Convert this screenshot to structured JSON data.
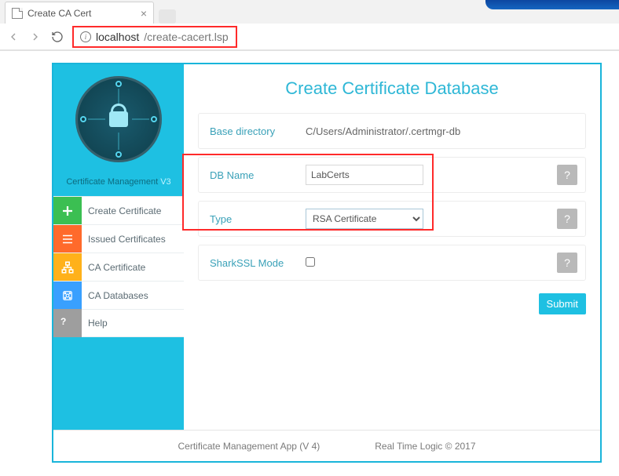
{
  "browser": {
    "tab_title": "Create CA Cert",
    "url_host": "localhost",
    "url_path": "/create-cacert.lsp"
  },
  "sidebar": {
    "title": "Certificate Management",
    "version": "V3",
    "items": [
      {
        "label": "Create Certificate"
      },
      {
        "label": "Issued Certificates"
      },
      {
        "label": "CA Certificate"
      },
      {
        "label": "CA Databases"
      },
      {
        "label": "Help"
      }
    ]
  },
  "main": {
    "title": "Create Certificate Database",
    "rows": {
      "base_dir_label": "Base directory",
      "base_dir_value": "C/Users/Administrator/.certmgr-db",
      "db_name_label": "DB Name",
      "db_name_value": "LabCerts",
      "type_label": "Type",
      "type_value": "RSA Certificate",
      "sharkssl_label": "SharkSSL Mode"
    },
    "help_symbol": "?",
    "submit_label": "Submit"
  },
  "footer": {
    "left": "Certificate Management App (V 4)",
    "right": "Real Time Logic © 2017"
  }
}
